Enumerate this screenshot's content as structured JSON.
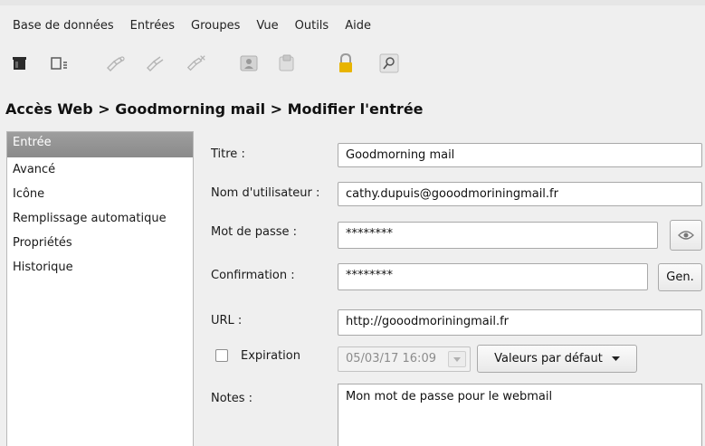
{
  "menubar": {
    "items": [
      "Base de données",
      "Entrées",
      "Groupes",
      "Vue",
      "Outils",
      "Aide"
    ]
  },
  "toolbar": {
    "icons": [
      "new-database-icon",
      "add-entry-icon",
      "edit-entry-icon",
      "delete-entry-icon",
      "clone-entry-icon",
      "copy-username-icon",
      "copy-password-icon",
      "lock-icon",
      "search-icon"
    ]
  },
  "breadcrumb": "Accès Web > Goodmorning mail > Modifier l'entrée",
  "sidebar": {
    "items": [
      "Entrée",
      "Avancé",
      "Icône",
      "Remplissage automatique",
      "Propriétés",
      "Historique"
    ],
    "selected_index": 0
  },
  "form": {
    "title_label": "Titre :",
    "title_value": "Goodmorning mail",
    "username_label": "Nom d'utilisateur :",
    "username_value": "cathy.dupuis@gooodmoriningmail.fr",
    "password_label": "Mot de passe :",
    "password_value": "********",
    "confirm_label": "Confirmation :",
    "confirm_value": "********",
    "gen_button": "Gen.",
    "url_label": "URL :",
    "url_value": "http://gooodmoriningmail.fr",
    "expiration_label": "Expiration",
    "expiration_checked": false,
    "expiration_value": "05/03/17 16:09",
    "defaults_button": "Valeurs par défaut",
    "notes_label": "Notes :",
    "notes_value": "Mon mot de passe pour le webmail"
  },
  "colors": {
    "background": "#efefef",
    "selection": "#929292",
    "lock_icon": "#e8b400"
  }
}
